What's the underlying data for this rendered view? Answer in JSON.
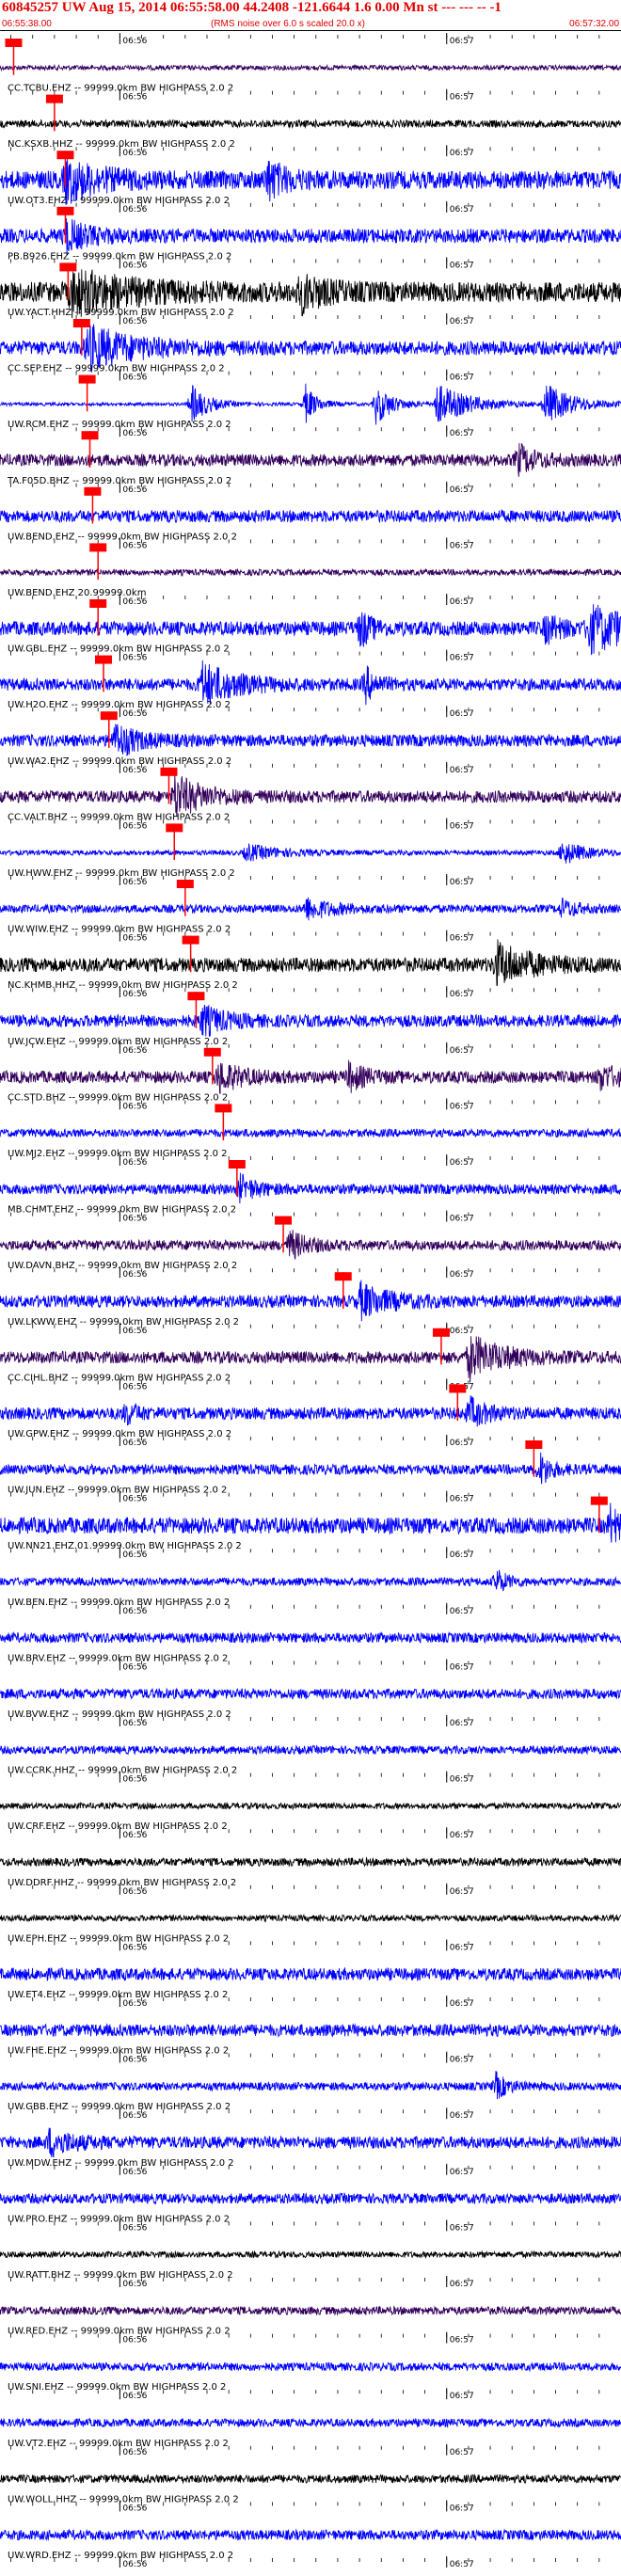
{
  "header": {
    "title": "60845257 UW Aug 15, 2014 06:55:58.00   44.2408 -121.6644  1.6 0.00 Mn st --- --- --   -1",
    "start_time": "06:55:38.00",
    "note": "(RMS noise over 6.0 s scaled 20.0 x)",
    "end_time": "06:57:32.00"
  },
  "chart_data": {
    "type": "line",
    "title": "60845257 UW Aug 15, 2014 06:55:58.00   44.2408 -121.6644  1.6 0.00 Mn st --- --- --   -1",
    "x_unit": "seconds after 06:55:38.00",
    "xlim": [
      0,
      114
    ],
    "minute_ticks": [
      {
        "t": 22,
        "label": "06:56"
      },
      {
        "t": 82,
        "label": "06:57"
      }
    ],
    "colors": {
      "blue": "#0000ff",
      "black": "#000000",
      "purple": "#33005c",
      "pick": "#ff0000"
    },
    "traces": [
      {
        "label": "",
        "color": "purple",
        "amp": 0.12,
        "pick": 2.5,
        "events": []
      },
      {
        "label": "CC.TCBU.EHZ -- 99999.0km BW HIGHPASS  2.0  2",
        "color": "black",
        "amp": 0.18,
        "pick": 10,
        "events": []
      },
      {
        "label": "NC.KSXB.HHZ -- 99999.0km BW HIGHPASS  2.0  2",
        "color": "blue",
        "amp": 0.45,
        "pick": 12,
        "events": [
          {
            "t": 12,
            "a": 0.9,
            "d": 6
          },
          {
            "t": 49,
            "a": 0.9,
            "d": 3
          }
        ]
      },
      {
        "label": "UW.OT3.EHZ -- 99999.0km BW HIGHPASS  2.0  2",
        "color": "blue",
        "amp": 0.35,
        "pick": 12,
        "events": [
          {
            "t": 12,
            "a": 0.7,
            "d": 4
          }
        ]
      },
      {
        "label": "PB.B926.EHZ -- 99999.0km BW HIGHPASS  2.0  2",
        "color": "black",
        "amp": 0.5,
        "pick": 12.5,
        "events": [
          {
            "t": 13,
            "a": 0.9,
            "d": 10
          },
          {
            "t": 55,
            "a": 0.8,
            "d": 4
          }
        ]
      },
      {
        "label": "UW.YACT.HHZ -- 99999.0km BW HIGHPASS  2.0  2",
        "color": "blue",
        "amp": 0.35,
        "pick": 15,
        "events": [
          {
            "t": 16,
            "a": 1.0,
            "d": 8
          }
        ]
      },
      {
        "label": "CC.SEP.EHZ -- 99999.0km BW HIGHPASS  2.0  2",
        "color": "blue",
        "amp": 0.08,
        "pick": 16,
        "events": [
          {
            "t": 35,
            "a": 1.0,
            "d": 3
          },
          {
            "t": 56,
            "a": 1.0,
            "d": 2
          },
          {
            "t": 69,
            "a": 1.0,
            "d": 3
          },
          {
            "t": 80,
            "a": 1.0,
            "d": 6
          },
          {
            "t": 100,
            "a": 1.0,
            "d": 5
          }
        ]
      },
      {
        "label": "UW.RCM.EHZ -- 99999.0km BW HIGHPASS  2.0  2",
        "color": "purple",
        "amp": 0.3,
        "pick": 16.5,
        "events": [
          {
            "t": 95,
            "a": 0.7,
            "d": 3
          }
        ]
      },
      {
        "label": "TA.F05D.BHZ -- 99999.0km BW HIGHPASS  2.0  2",
        "color": "blue",
        "amp": 0.3,
        "pick": 17,
        "events": []
      },
      {
        "label": "UW.BEND.EHZ -- 99999.0km BW HIGHPASS  2.0  2",
        "color": "purple",
        "amp": 0.15,
        "pick": 18,
        "events": []
      },
      {
        "label": "UW.BEND.EHZ 20.99999.0km",
        "color": "blue",
        "amp": 0.35,
        "pick": 18,
        "events": [
          {
            "t": 66,
            "a": 0.9,
            "d": 2
          },
          {
            "t": 100,
            "a": 0.6,
            "d": 3
          },
          {
            "t": 108,
            "a": 1.0,
            "d": 10
          }
        ]
      },
      {
        "label": "UW.GBL.EHZ -- 99999.0km BW HIGHPASS  2.0  2",
        "color": "blue",
        "amp": 0.3,
        "pick": 19,
        "events": [
          {
            "t": 37,
            "a": 1.0,
            "d": 6
          },
          {
            "t": 67,
            "a": 0.8,
            "d": 2
          }
        ]
      },
      {
        "label": "UW.H2O.EHZ -- 99999.0km BW HIGHPASS  2.0  2",
        "color": "blue",
        "amp": 0.3,
        "pick": 20,
        "events": [
          {
            "t": 21,
            "a": 0.8,
            "d": 4
          }
        ]
      },
      {
        "label": "UW.WA2.EHZ -- 99999.0km BW HIGHPASS  2.0  2",
        "color": "purple",
        "amp": 0.3,
        "pick": 31,
        "events": [
          {
            "t": 32,
            "a": 1.0,
            "d": 5
          }
        ]
      },
      {
        "label": "CC.VALT.BHZ -- 99999.0km BW HIGHPASS  2.0  2",
        "color": "blue",
        "amp": 0.12,
        "pick": 32,
        "events": [
          {
            "t": 45,
            "a": 0.4,
            "d": 6
          },
          {
            "t": 103,
            "a": 0.6,
            "d": 4
          }
        ]
      },
      {
        "label": "UW.HWW.EHZ -- 99999.0km BW HIGHPASS  2.0  2",
        "color": "blue",
        "amp": 0.2,
        "pick": 34,
        "events": [
          {
            "t": 56,
            "a": 0.5,
            "d": 5
          },
          {
            "t": 103,
            "a": 0.4,
            "d": 3
          }
        ]
      },
      {
        "label": "UW.WIW.EHZ -- 99999.0km BW HIGHPASS  2.0  2",
        "color": "black",
        "amp": 0.35,
        "pick": 35,
        "events": [
          {
            "t": 91,
            "a": 1.0,
            "d": 6
          }
        ]
      },
      {
        "label": "NC.KHMB.HHZ -- 99999.0km BW HIGHPASS  2.0  2",
        "color": "blue",
        "amp": 0.3,
        "pick": 36,
        "events": [
          {
            "t": 37,
            "a": 0.7,
            "d": 4
          }
        ]
      },
      {
        "label": "UW.JCW.EHZ -- 99999.0km BW HIGHPASS  2.0  2",
        "color": "purple",
        "amp": 0.3,
        "pick": 39,
        "events": [
          {
            "t": 40,
            "a": 0.7,
            "d": 4
          },
          {
            "t": 64,
            "a": 0.6,
            "d": 3
          },
          {
            "t": 110,
            "a": 0.5,
            "d": 4
          }
        ]
      },
      {
        "label": "CC.STD.BHZ -- 99999.0km BW HIGHPASS  2.0  2",
        "color": "blue",
        "amp": 0.2,
        "pick": 41,
        "events": []
      },
      {
        "label": "UW.MJ2.EHZ -- 99999.0km BW HIGHPASS  2.0  2",
        "color": "blue",
        "amp": 0.25,
        "pick": 43.5,
        "events": [
          {
            "t": 44,
            "a": 0.6,
            "d": 3
          }
        ]
      },
      {
        "label": "MB.CHMT.EHZ -- 99999.0km BW HIGHPASS  2.0  2",
        "color": "purple",
        "amp": 0.25,
        "pick": 52,
        "events": [
          {
            "t": 53,
            "a": 0.7,
            "d": 3
          }
        ]
      },
      {
        "label": "UW.DAVN.BHZ -- 99999.0km BW HIGHPASS  2.0  2",
        "color": "blue",
        "amp": 0.3,
        "pick": 63,
        "events": [
          {
            "t": 66,
            "a": 0.8,
            "d": 5
          }
        ]
      },
      {
        "label": "UW.LKWW.EHZ -- 99999.0km BW HIGHPASS  2.0  2",
        "color": "purple",
        "amp": 0.3,
        "pick": 81,
        "events": [
          {
            "t": 86,
            "a": 1.0,
            "d": 6
          }
        ]
      },
      {
        "label": "CC.CIHL.BHZ -- 99999.0km BW HIGHPASS  2.0  2",
        "color": "blue",
        "amp": 0.3,
        "pick": 84,
        "events": [
          {
            "t": 23,
            "a": 0.5,
            "d": 2
          },
          {
            "t": 86,
            "a": 0.7,
            "d": 3
          }
        ]
      },
      {
        "label": "UW.GPW.EHZ -- 99999.0km BW HIGHPASS  2.0  2",
        "color": "blue",
        "amp": 0.25,
        "pick": 98,
        "events": [
          {
            "t": 99,
            "a": 0.8,
            "d": 2
          }
        ]
      },
      {
        "label": "UW.JUN.EHZ -- 99999.0km BW HIGHPASS  2.0  2",
        "color": "blue",
        "amp": 0.4,
        "pick": 110,
        "events": [
          {
            "t": 112,
            "a": 0.8,
            "d": 2
          }
        ]
      },
      {
        "label": "UW.NN21.EHZ.01.99999.0km BW HIGHPASS  2.0  2",
        "color": "blue",
        "amp": 0.2,
        "pick": null,
        "events": [
          {
            "t": 91,
            "a": 0.6,
            "d": 2
          }
        ]
      },
      {
        "label": "UW.BEN.EHZ -- 99999.0km BW HIGHPASS  2.0  2",
        "color": "blue",
        "amp": 0.25,
        "pick": null,
        "events": []
      },
      {
        "label": "UW.BRV.EHZ -- 99999.0km BW HIGHPASS  2.0  2",
        "color": "blue",
        "amp": 0.25,
        "pick": null,
        "events": []
      },
      {
        "label": "UW.BVW.EHZ -- 99999.0km BW HIGHPASS  2.0  2",
        "color": "blue",
        "amp": 0.2,
        "pick": null,
        "events": []
      },
      {
        "label": "UW.CCRK.HHZ -- 99999.0km BW HIGHPASS  2.0  2",
        "color": "black",
        "amp": 0.15,
        "pick": null,
        "events": []
      },
      {
        "label": "UW.CRF.EHZ -- 99999.0km BW HIGHPASS  2.0  2",
        "color": "black",
        "amp": 0.2,
        "pick": null,
        "events": []
      },
      {
        "label": "UW.DDRF.HHZ -- 99999.0km BW HIGHPASS  2.0  2",
        "color": "black",
        "amp": 0.15,
        "pick": null,
        "events": []
      },
      {
        "label": "UW.EPH.EHZ -- 99999.0km BW HIGHPASS  2.0  2",
        "color": "blue",
        "amp": 0.3,
        "pick": null,
        "events": []
      },
      {
        "label": "UW.ET4.EHZ -- 99999.0km BW HIGHPASS  2.0  2",
        "color": "blue",
        "amp": 0.3,
        "pick": null,
        "events": []
      },
      {
        "label": "UW.FHE.EHZ -- 99999.0km BW HIGHPASS  2.0  2",
        "color": "blue",
        "amp": 0.2,
        "pick": null,
        "events": [
          {
            "t": 91,
            "a": 0.6,
            "d": 2
          }
        ]
      },
      {
        "label": "UW.GBB.EHZ -- 99999.0km BW HIGHPASS  2.0  2",
        "color": "blue",
        "amp": 0.3,
        "pick": null,
        "events": [
          {
            "t": 9,
            "a": 0.6,
            "d": 4
          }
        ]
      },
      {
        "label": "UW.MDW.EHZ -- 99999.0km BW HIGHPASS  2.0  2",
        "color": "blue",
        "amp": 0.25,
        "pick": null,
        "events": []
      },
      {
        "label": "UW.PRO.EHZ -- 99999.0km BW HIGHPASS  2.0  2",
        "color": "black",
        "amp": 0.15,
        "pick": null,
        "events": []
      },
      {
        "label": "UW.RATT.BHZ -- 99999.0km BW HIGHPASS  2.0  2",
        "color": "purple",
        "amp": 0.2,
        "pick": null,
        "events": []
      },
      {
        "label": "UW.RED.EHZ -- 99999.0km BW HIGHPASS  2.0  2",
        "color": "blue",
        "amp": 0.2,
        "pick": null,
        "events": []
      },
      {
        "label": "UW.SNI.EHZ -- 99999.0km BW HIGHPASS  2.0  2",
        "color": "blue",
        "amp": 0.2,
        "pick": null,
        "events": []
      },
      {
        "label": "UW.VT2.EHZ -- 99999.0km BW HIGHPASS  2.0  2",
        "color": "black",
        "amp": 0.2,
        "pick": null,
        "events": []
      },
      {
        "label": "UW.WOLL.HHZ -- 99999.0km BW HIGHPASS  2.0  2",
        "color": "blue",
        "amp": 0.25,
        "pick": null,
        "events": []
      },
      {
        "label": "UW.WRD.EHZ -- 99999.0km BW HIGHPASS  2.0  2",
        "color": "black",
        "amp": 0.15,
        "pick": null,
        "events": []
      }
    ]
  }
}
